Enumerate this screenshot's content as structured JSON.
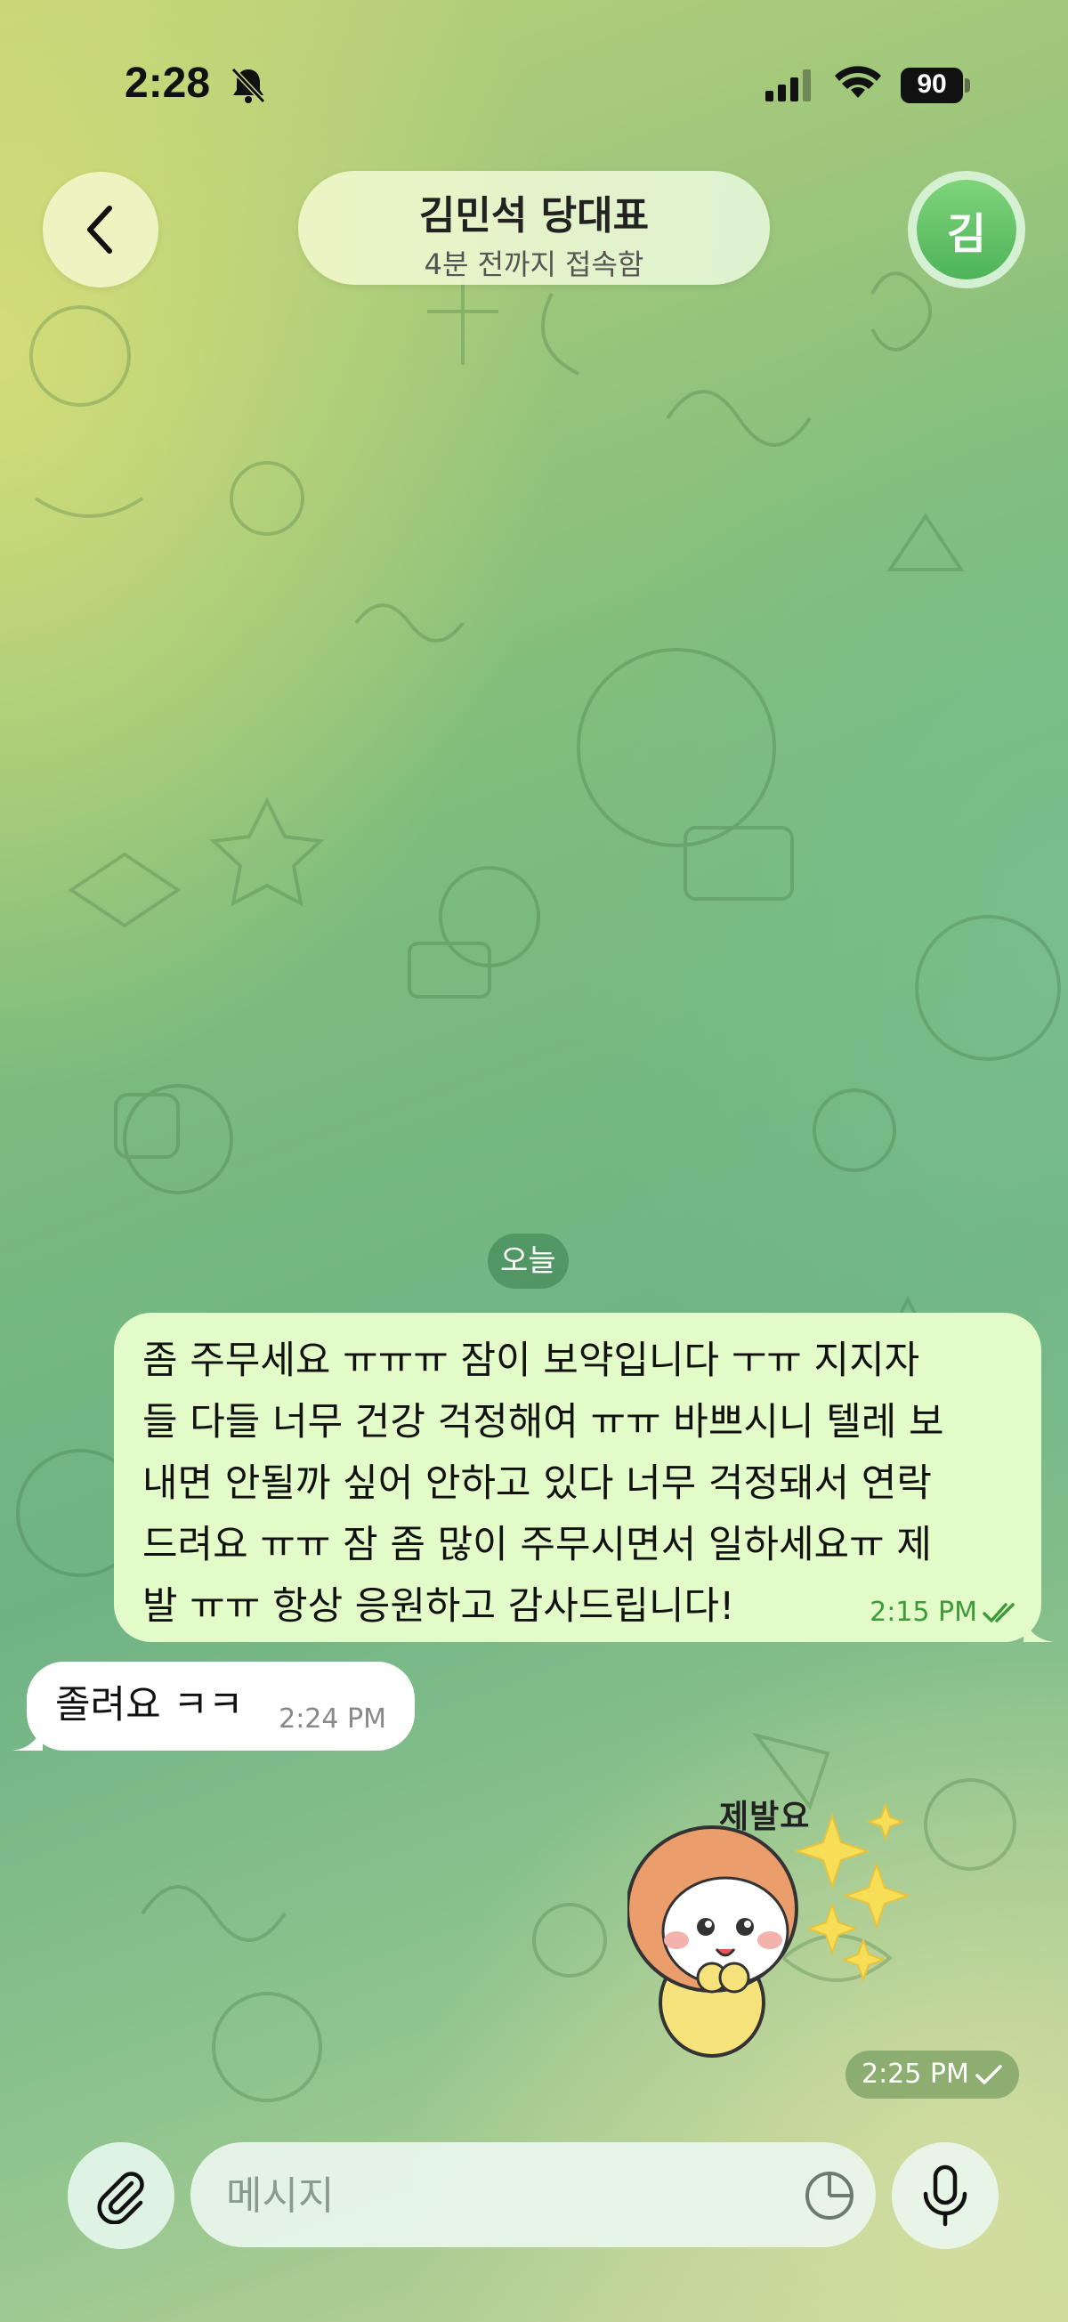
{
  "status_bar": {
    "time": "2:28",
    "battery": "90"
  },
  "header": {
    "back_icon": "chevron-left-icon",
    "name": "김민석 당대표",
    "status": "4분 전까지 접속함",
    "avatar_letter": "김",
    "avatar_color": "#5cbd60"
  },
  "chat": {
    "date_label": "오늘",
    "messages": [
      {
        "direction": "outgoing",
        "text": "좀 주무세요 ㅠㅠㅠ 잠이 보약입니다 ㅜㅠ 지지자\n들 다들 너무 건강 걱정해여 ㅠㅠ 바쁘시니 텔레 보\n내면 안될까 싶어 안하고 있다 너무 걱정돼서 연락\n드려요 ㅠㅠ 잠 좀 많이 주무시면서 일하세요ㅠ 제\n발 ㅠㅠ 항상 응원하고 감사드립니다!",
        "time": "2:15 PM",
        "read_status": "double-check-icon"
      },
      {
        "direction": "incoming",
        "text": "졸려요 ㅋㅋ",
        "time": "2:24 PM"
      },
      {
        "direction": "outgoing",
        "type": "sticker",
        "sticker_text": "제발요",
        "time": "2:25 PM",
        "read_status": "check-icon"
      }
    ]
  },
  "composer": {
    "placeholder": "메시지",
    "attach_icon": "paperclip-icon",
    "sticker_icon": "sticker-icon",
    "mic_icon": "microphone-icon"
  },
  "colors": {
    "outgoing_bubble": "#e2fbc9",
    "incoming_bubble": "#ffffff",
    "outgoing_time": "#3f9a3a",
    "accent_green": "#4eb35a"
  }
}
